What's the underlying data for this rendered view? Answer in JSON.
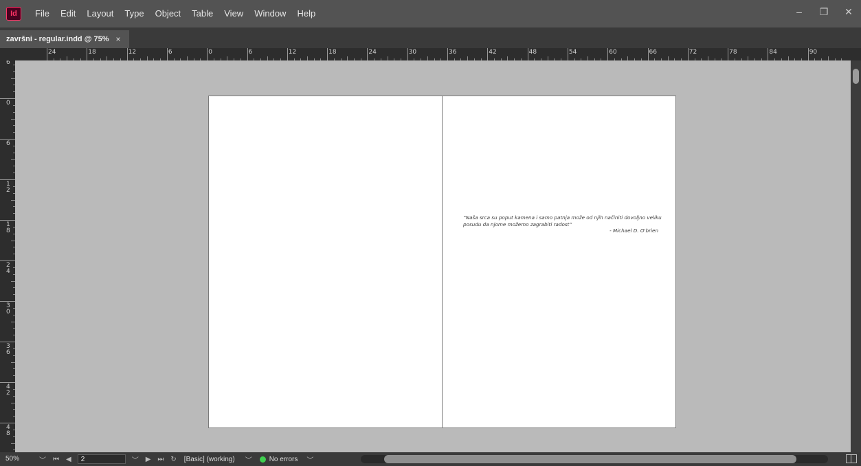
{
  "app": {
    "logo_text": "Id",
    "menu": [
      "File",
      "Edit",
      "Layout",
      "Type",
      "Object",
      "Table",
      "View",
      "Window",
      "Help"
    ],
    "window_controls": {
      "minimize": "–",
      "restore": "❐",
      "close": "✕"
    }
  },
  "document_tab": {
    "title": "završni - regular.indd @ 75%",
    "close": "×"
  },
  "rulers": {
    "horizontal_labels": [
      "24",
      "18",
      "12",
      "6",
      "0",
      "6",
      "12",
      "18",
      "24",
      "30",
      "36",
      "42",
      "48",
      "54",
      "60",
      "66",
      "72",
      "78",
      "84",
      "90"
    ],
    "vertical_labels": [
      "6",
      "0",
      "6",
      "12",
      "18",
      "24",
      "30",
      "36",
      "42",
      "48"
    ]
  },
  "spread": {
    "quote_text": "“Naša srca su poput kamena i samo patnja može od njih načiniti dovoljno veliku posudu da njome možemo zagrabiti radost”",
    "quote_author": "- Michael D. O'brien"
  },
  "status_bar": {
    "zoom": "50%",
    "page": "2",
    "style": "[Basic] (working)",
    "preflight": "No errors"
  },
  "colors": {
    "accent": "#ff3366",
    "pasteboard": "#bababa",
    "ok": "#3fcf4f"
  }
}
